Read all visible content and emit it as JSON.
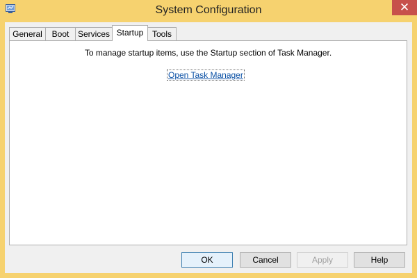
{
  "window": {
    "title": "System Configuration",
    "close_glyph": "✕",
    "icon": "msconfig-icon"
  },
  "tabs": [
    {
      "label": "General",
      "active": false
    },
    {
      "label": "Boot",
      "active": false
    },
    {
      "label": "Services",
      "active": false
    },
    {
      "label": "Startup",
      "active": true
    },
    {
      "label": "Tools",
      "active": false
    }
  ],
  "startup": {
    "message": "To manage startup items, use the Startup section of Task Manager.",
    "link_label": "Open Task Manager"
  },
  "buttons": {
    "ok": "OK",
    "cancel": "Cancel",
    "apply": "Apply",
    "help": "Help"
  },
  "colors": {
    "window_frame": "#f6d26f",
    "close_button": "#c7504b",
    "link": "#0a50a5"
  }
}
